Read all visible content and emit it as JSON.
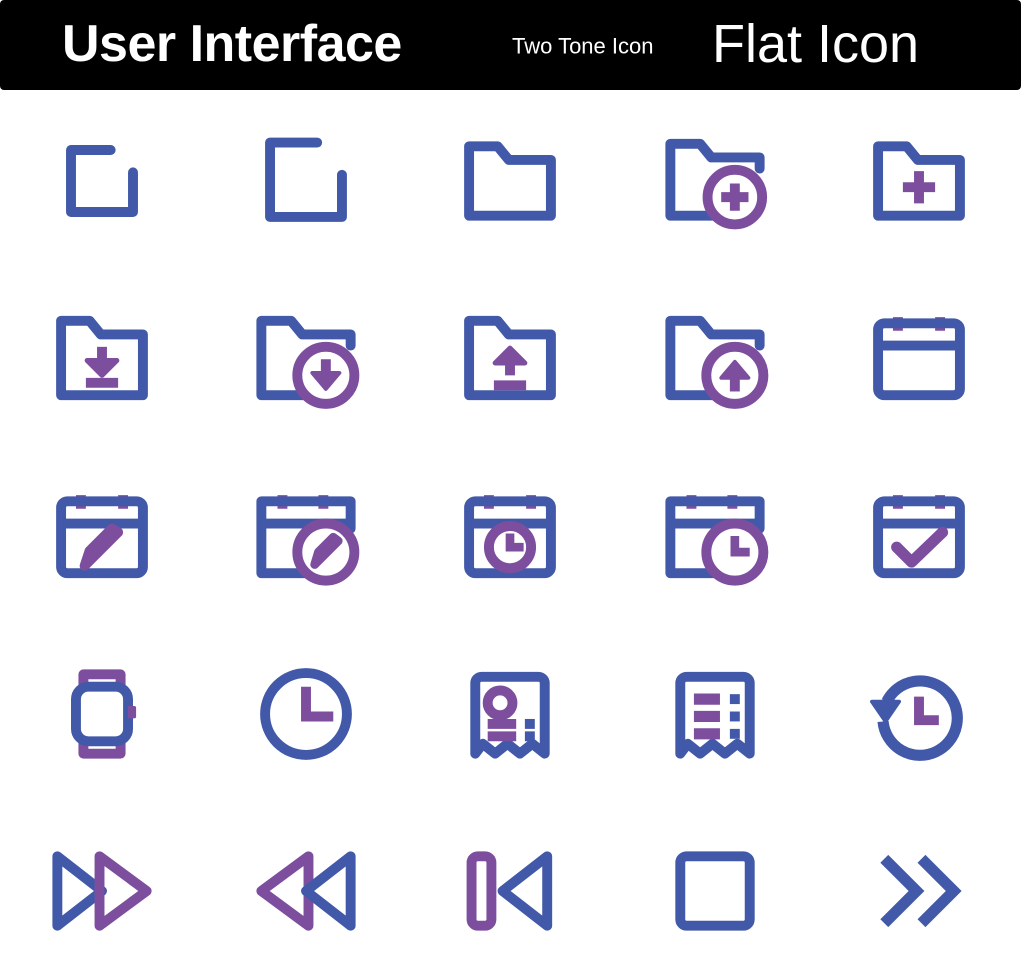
{
  "header": {
    "title_main": "User Interface",
    "title_sub": "Two Tone Icon",
    "title_right": "Flat Icon",
    "background_color": "#000000",
    "text_color": "#ffffff"
  },
  "palette": {
    "blue": "#4159a8",
    "purple": "#7e4e9e",
    "background": "#ffffff"
  },
  "grid": {
    "columns": 5,
    "rows": 5,
    "total_icons": 25
  },
  "icons": [
    {
      "index": 1,
      "row": 1,
      "col": 1,
      "name": "folder-outline-small-icon",
      "label": "Folder Outline Small"
    },
    {
      "index": 2,
      "row": 1,
      "col": 2,
      "name": "folder-outline-large-icon",
      "label": "Folder Outline Large"
    },
    {
      "index": 3,
      "row": 1,
      "col": 3,
      "name": "folder-icon",
      "label": "Folder"
    },
    {
      "index": 4,
      "row": 1,
      "col": 4,
      "name": "folder-add-badge-icon",
      "label": "Folder Add Badge"
    },
    {
      "index": 5,
      "row": 1,
      "col": 5,
      "name": "folder-plus-icon",
      "label": "Folder Plus"
    },
    {
      "index": 6,
      "row": 2,
      "col": 1,
      "name": "folder-download-icon",
      "label": "Folder Download"
    },
    {
      "index": 7,
      "row": 2,
      "col": 2,
      "name": "folder-download-badge-icon",
      "label": "Folder Download Badge"
    },
    {
      "index": 8,
      "row": 2,
      "col": 3,
      "name": "folder-upload-icon",
      "label": "Folder Upload"
    },
    {
      "index": 9,
      "row": 2,
      "col": 4,
      "name": "folder-upload-badge-icon",
      "label": "Folder Upload Badge"
    },
    {
      "index": 10,
      "row": 2,
      "col": 5,
      "name": "calendar-icon",
      "label": "Calendar"
    },
    {
      "index": 11,
      "row": 3,
      "col": 1,
      "name": "calendar-edit-icon",
      "label": "Calendar Edit"
    },
    {
      "index": 12,
      "row": 3,
      "col": 2,
      "name": "calendar-edit-badge-icon",
      "label": "Calendar Edit Badge"
    },
    {
      "index": 13,
      "row": 3,
      "col": 3,
      "name": "calendar-clock-icon",
      "label": "Calendar Clock"
    },
    {
      "index": 14,
      "row": 3,
      "col": 4,
      "name": "calendar-clock-badge-icon",
      "label": "Calendar Clock Badge"
    },
    {
      "index": 15,
      "row": 3,
      "col": 5,
      "name": "calendar-check-icon",
      "label": "Calendar Check"
    },
    {
      "index": 16,
      "row": 4,
      "col": 1,
      "name": "smartwatch-icon",
      "label": "Smartwatch"
    },
    {
      "index": 17,
      "row": 4,
      "col": 2,
      "name": "clock-icon",
      "label": "Clock"
    },
    {
      "index": 18,
      "row": 4,
      "col": 3,
      "name": "receipt-profile-icon",
      "label": "Receipt Profile"
    },
    {
      "index": 19,
      "row": 4,
      "col": 4,
      "name": "receipt-list-icon",
      "label": "Receipt List"
    },
    {
      "index": 20,
      "row": 4,
      "col": 5,
      "name": "history-clock-icon",
      "label": "History Clock"
    },
    {
      "index": 21,
      "row": 5,
      "col": 1,
      "name": "fast-forward-icon",
      "label": "Fast Forward"
    },
    {
      "index": 22,
      "row": 5,
      "col": 2,
      "name": "rewind-icon",
      "label": "Rewind"
    },
    {
      "index": 23,
      "row": 5,
      "col": 3,
      "name": "skip-previous-icon",
      "label": "Skip Previous"
    },
    {
      "index": 24,
      "row": 5,
      "col": 4,
      "name": "stop-square-icon",
      "label": "Stop"
    },
    {
      "index": 25,
      "row": 5,
      "col": 5,
      "name": "double-chevron-right-icon",
      "label": "Double Chevron Right"
    }
  ]
}
